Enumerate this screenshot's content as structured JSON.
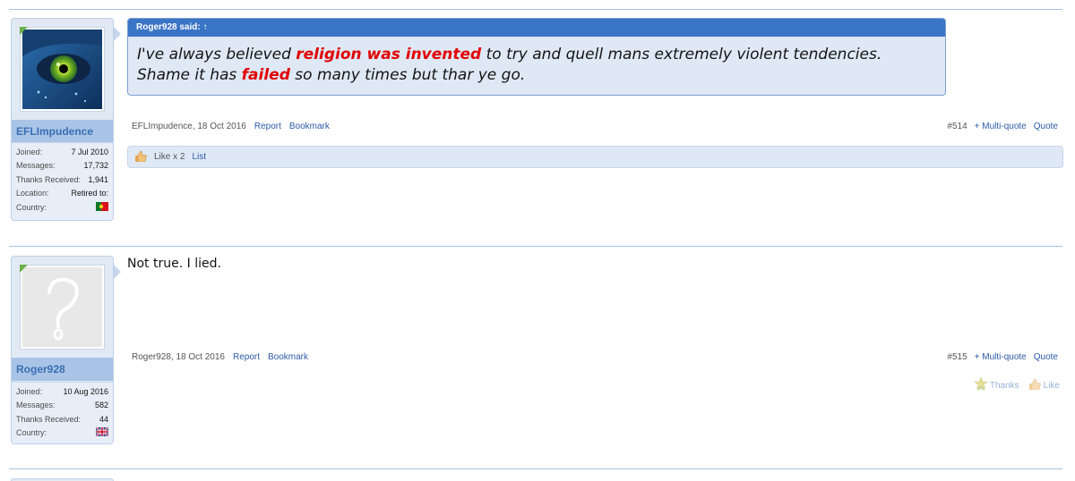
{
  "posts": [
    {
      "user": {
        "name": "EFLImpudence",
        "stats": [
          {
            "label": "Joined:",
            "value": "7 Jul 2010"
          },
          {
            "label": "Messages:",
            "value": "17,732"
          },
          {
            "label": "Thanks Received:",
            "value": "1,941"
          },
          {
            "label": "Location:",
            "value": "Retired to:"
          },
          {
            "label": "Country:",
            "value": "flag-portugal"
          }
        ]
      },
      "quote": {
        "header": "Roger928 said: ↑",
        "line1_a": "I've always believed ",
        "line1_hl": "religion was invented",
        "line1_b": " to try and quell mans extremely violent tendencies.",
        "line2_a": "Shame it has ",
        "line2_hl": "failed",
        "line2_b": " so many times but thar ye go."
      },
      "meta": {
        "author_date": "EFLImpudence, 18 Oct 2016",
        "report": "Report",
        "bookmark": "Bookmark",
        "post_number": "#514",
        "multiquote": "+ Multi-quote",
        "quote": "Quote"
      },
      "likes": {
        "text": "Like x 2",
        "list": "List"
      }
    },
    {
      "user": {
        "name": "Roger928",
        "stats": [
          {
            "label": "Joined:",
            "value": "10 Aug 2016"
          },
          {
            "label": "Messages:",
            "value": "582"
          },
          {
            "label": "Thanks Received:",
            "value": "44"
          },
          {
            "label": "Country:",
            "value": "flag-uk"
          }
        ]
      },
      "body": "Not true. I lied.",
      "meta": {
        "author_date": "Roger928, 18 Oct 2016",
        "report": "Report",
        "bookmark": "Bookmark",
        "post_number": "#515",
        "multiquote": "+ Multi-quote",
        "quote": "Quote"
      },
      "actions": {
        "thanks": "Thanks",
        "like": "Like"
      }
    }
  ],
  "colors": {
    "accent": "#3a74c6",
    "highlight": "#e00000",
    "link": "#2b5aa6"
  }
}
